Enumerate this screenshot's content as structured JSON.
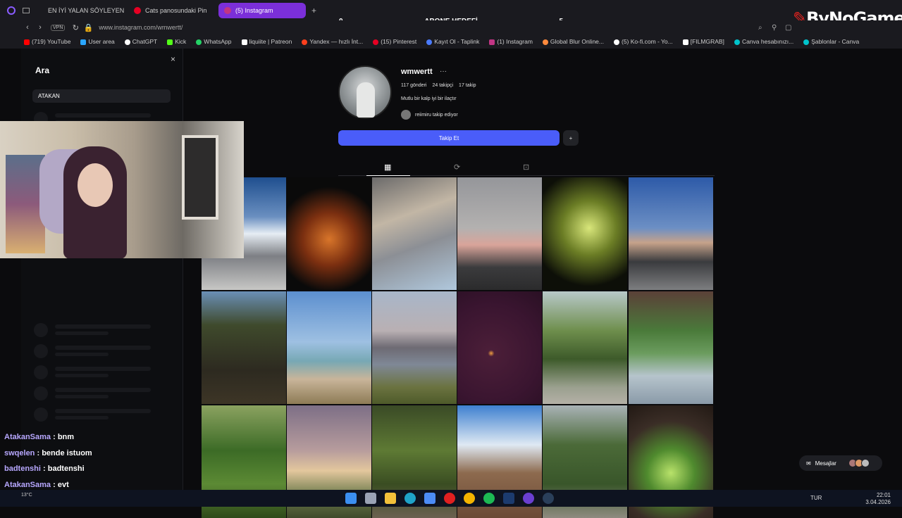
{
  "browser": {
    "tabs": [
      {
        "label": "EN İYİ YALAN SÖYLEYEN",
        "color": "#e02020"
      },
      {
        "label": "Cats panosundaki Pin",
        "color": "#e60023"
      },
      {
        "label": "(5) Instagram",
        "color": "#c13584"
      }
    ],
    "url": "www.instagram.com/wmwertt/",
    "vpn": "VPN",
    "bookmarks": [
      {
        "label": "(719) YouTube",
        "color": "#ff0000"
      },
      {
        "label": "User area",
        "color": "#2aa6ff"
      },
      {
        "label": "ChatGPT",
        "color": "#ffffff"
      },
      {
        "label": "Kick",
        "color": "#53fc18"
      },
      {
        "label": "WhatsApp",
        "color": "#25d366"
      },
      {
        "label": "liquiite | Patreon",
        "color": "#ffffff"
      },
      {
        "label": "Yandex — hızlı İnt...",
        "color": "#fc3f1d"
      },
      {
        "label": "(15) Pinterest",
        "color": "#e60023"
      },
      {
        "label": "Kayıt Ol - Taplink",
        "color": "#4a7bff"
      },
      {
        "label": "(1) Instagram",
        "color": "#c13584"
      },
      {
        "label": "Global Blur Online...",
        "color": "#ff8a3d"
      },
      {
        "label": "(5) Ko-fi.com - Yo...",
        "color": "#ffffff"
      },
      {
        "label": "[FILMGRAB]",
        "color": "#ffffff"
      },
      {
        "label": "Canva hesabınızı...",
        "color": "#00c4cc"
      },
      {
        "label": "Şablonlar - Canva",
        "color": "#00c4cc"
      }
    ]
  },
  "overlay": {
    "left_count": "0",
    "goal": "ABONE HEDEFİ",
    "right_count": "5",
    "brand": "ByNoGame"
  },
  "search": {
    "title": "Ara",
    "query": "ATAKAN"
  },
  "profile": {
    "username": "wmwertt",
    "posts": "117 gönderi",
    "followers": "24 takipçi",
    "following": "17 takip",
    "bio": "Mutlu bir kalp iyi bir ilaçtır",
    "followed_by": "reiimiru takip ediyor",
    "follow_label": "Takip Et"
  },
  "chat": [
    {
      "user": "AtakanSama",
      "msg": ": bnm"
    },
    {
      "user": "swqelen",
      "msg": ": bende istuom"
    },
    {
      "user": "badtenshi",
      "msg": ": badtenshi"
    },
    {
      "user": "AtakanSama",
      "msg": ": evt"
    }
  ],
  "messages_label": "Mesajlar",
  "taskbar": {
    "lang": "TUR",
    "time": "22:01",
    "date": "3.04.2026",
    "weather": "13°C"
  }
}
